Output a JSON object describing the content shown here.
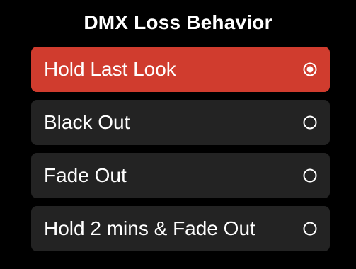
{
  "title": "DMX Loss Behavior",
  "options": [
    {
      "label": "Hold Last Look",
      "selected": true
    },
    {
      "label": "Black Out",
      "selected": false
    },
    {
      "label": "Fade Out",
      "selected": false
    },
    {
      "label": "Hold 2 mins & Fade Out",
      "selected": false
    }
  ],
  "colors": {
    "background": "#000000",
    "option_bg": "#232323",
    "selected_bg": "#d03c2e",
    "text": "#ffffff"
  },
  "icons": {
    "selected": "radio-selected-icon",
    "unselected": "radio-unselected-icon"
  }
}
